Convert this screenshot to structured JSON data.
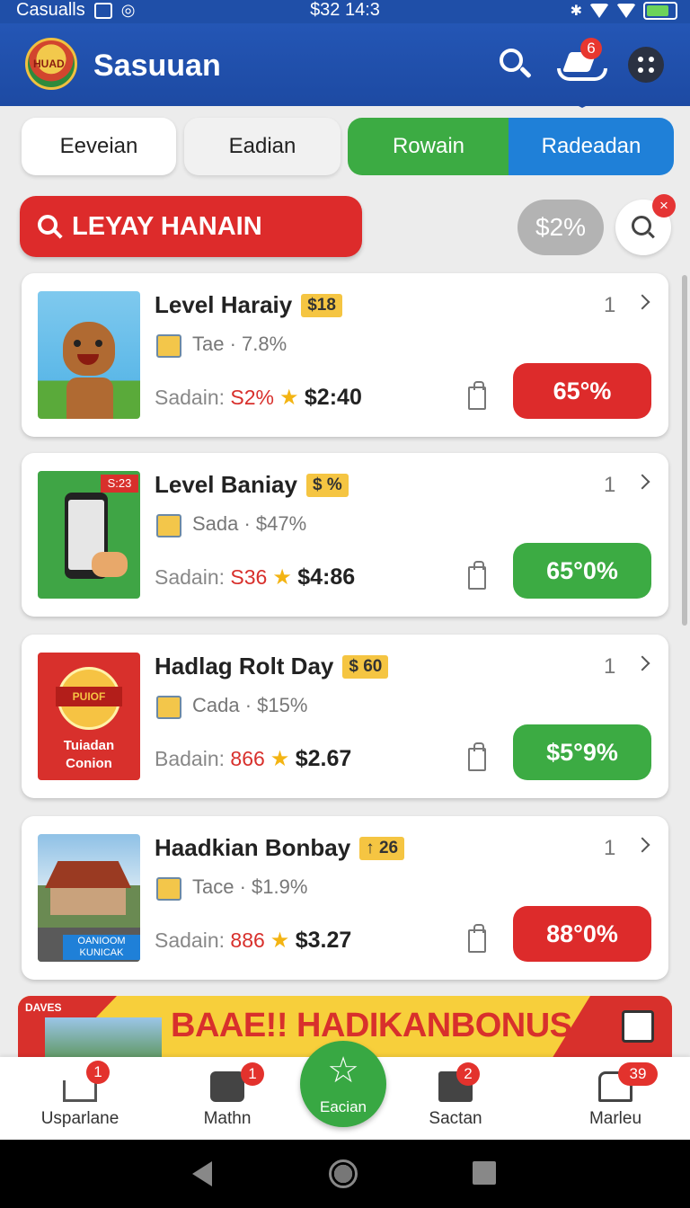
{
  "status_bar": {
    "carrier": "Casualls",
    "time": "$32 14:3"
  },
  "app_bar": {
    "title": "Sasuuan",
    "logo_text": "HUAD",
    "cart_badge": "6"
  },
  "tabs": [
    {
      "label": "Eeveian"
    },
    {
      "label": "Eadian"
    },
    {
      "label": "Rowain"
    },
    {
      "label": "Radeadan"
    }
  ],
  "search": {
    "label": "LEYAY HANAIN"
  },
  "filter": {
    "price_chip": "$2%",
    "badge": "×"
  },
  "deals": [
    {
      "title": "Level Haraiy",
      "tag": "$18",
      "count": "1",
      "sub": "Tae · 7.8%",
      "meta_label": "Sadain:",
      "meta_red": "S2%",
      "price": "$2:40",
      "action": "65°%",
      "action_color": "#dd2b2b",
      "thumb_top": "",
      "thumb_bottom": ""
    },
    {
      "title": "Level Baniay",
      "tag": "$ %",
      "count": "1",
      "sub": "Sada · $47%",
      "meta_label": "Sadain:",
      "meta_red": "S36",
      "price": "$4:86",
      "action": "65°0%",
      "action_color": "#3cab43",
      "thumb_top": "S:23",
      "thumb_bottom": ""
    },
    {
      "title": "Hadlag Rolt Day",
      "tag": "$ 60",
      "count": "1",
      "sub": "Cada · $15%",
      "meta_label": "Badain:",
      "meta_red": "866",
      "price": "$2.67",
      "action": "$5°9%",
      "action_color": "#3cab43",
      "thumb_top": "PUIOF",
      "thumb_bottom": "Tuiadan Conion"
    },
    {
      "title": "Haadkian Bonbay",
      "tag": "↑ 26",
      "count": "1",
      "sub": "Tace · $1.9%",
      "meta_label": "Sadain:",
      "meta_red": "886",
      "price": "$3.27",
      "action": "88°0%",
      "action_color": "#dd2b2b",
      "thumb_top": "",
      "thumb_bottom": "OANIOOM KUNICAK"
    }
  ],
  "banner": {
    "text": "BAAE!! HADIKANBONUS",
    "left_tag": "DAVES"
  },
  "bottom_nav": [
    {
      "label": "Usparlane",
      "badge": "1"
    },
    {
      "label": "Mathn",
      "badge": "1"
    },
    {
      "label": "Eacian",
      "badge": ""
    },
    {
      "label": "Sactan",
      "badge": "2"
    },
    {
      "label": "Marleu",
      "badge": "39"
    }
  ],
  "colors": {
    "primary_blue": "#1f4fa8",
    "red": "#dd2b2b",
    "green": "#3cab43",
    "accent_blue": "#1f80d8"
  }
}
